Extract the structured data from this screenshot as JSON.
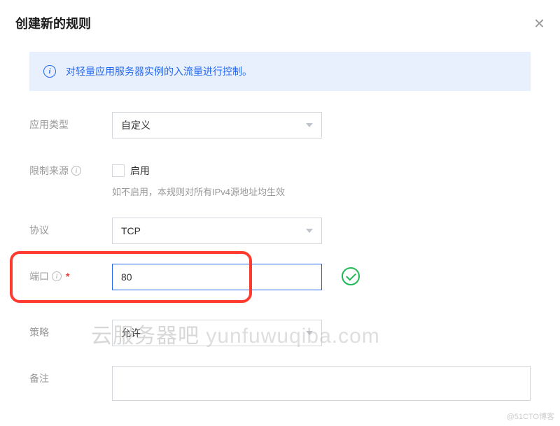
{
  "title": "创建新的规则",
  "banner": {
    "text": "对轻量应用服务器实例的入流量进行控制。"
  },
  "labels": {
    "appType": "应用类型",
    "restrictSource": "限制来源",
    "protocol": "协议",
    "port": "端口",
    "policy": "策略",
    "remark": "备注"
  },
  "values": {
    "appType": "自定义",
    "enable": "启用",
    "restrictHint": "如不启用，本规则对所有IPv4源地址均生效",
    "protocol": "TCP",
    "port": "80",
    "policy": "允许",
    "remark": ""
  },
  "watermark": {
    "cn": "云服务器吧",
    "en": " yunfuwuqiba.com"
  },
  "footerWatermark": "@51CTO博客"
}
